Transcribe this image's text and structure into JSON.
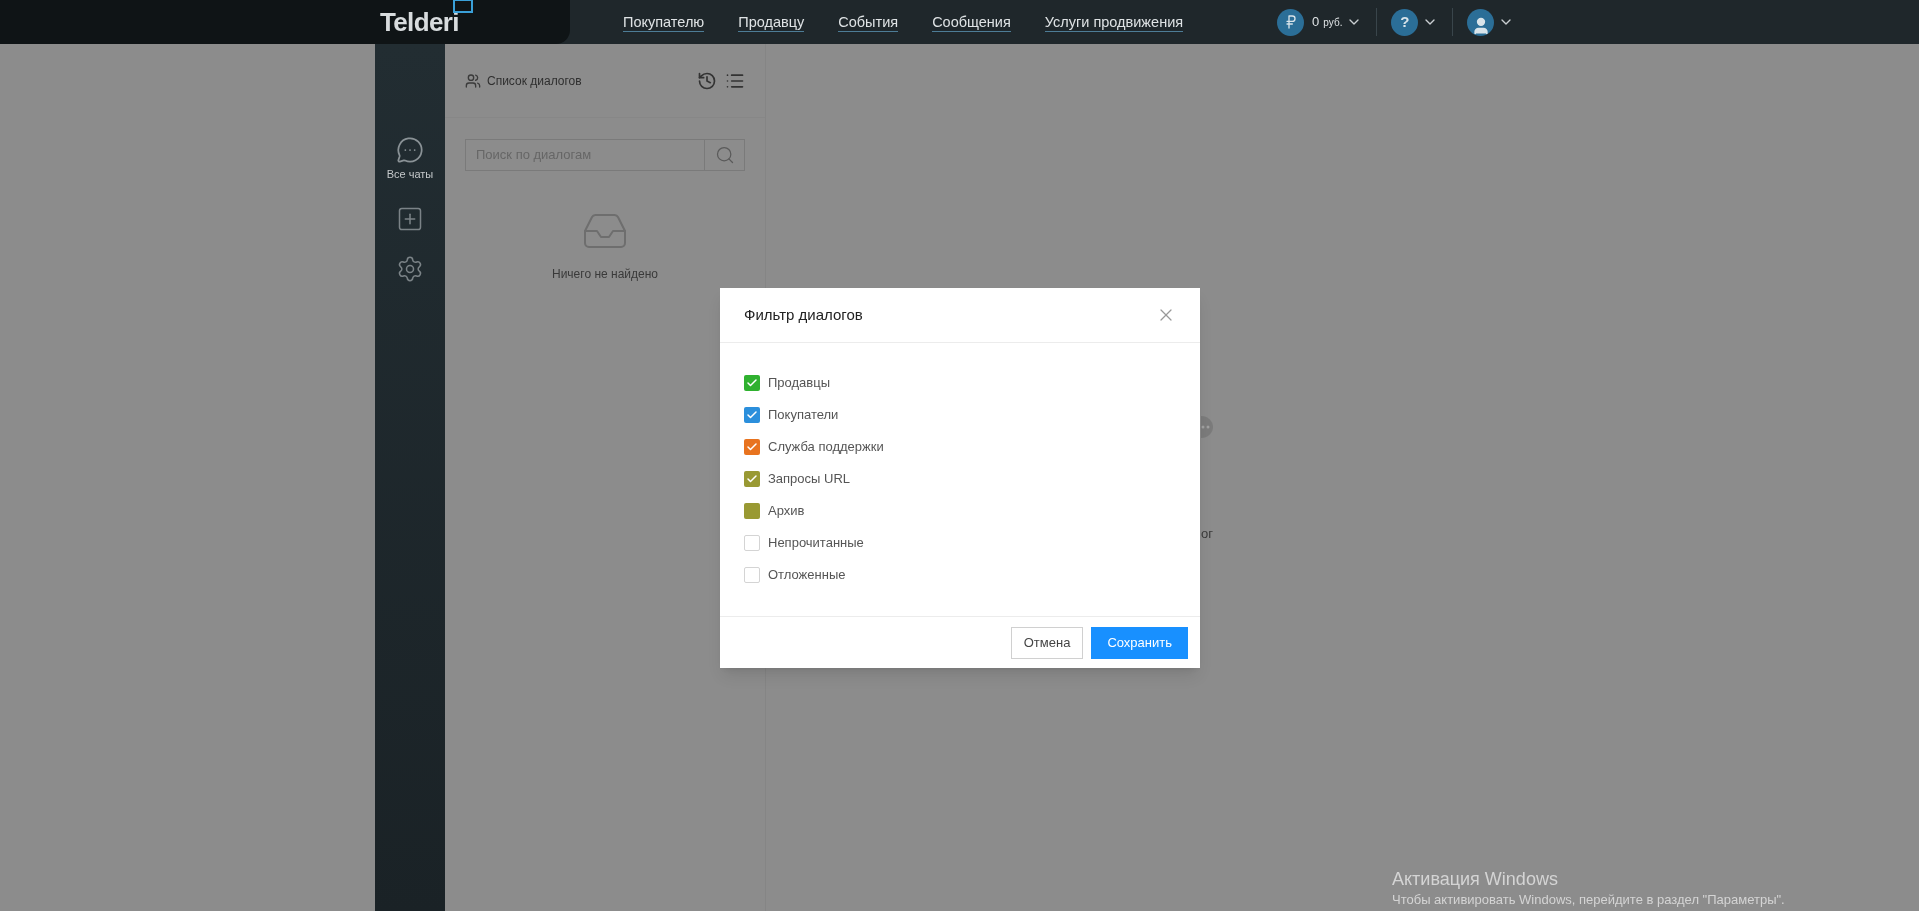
{
  "header": {
    "logo": "Telderi",
    "nav": [
      "Покупателю",
      "Продавцу",
      "События",
      "Сообщения",
      "Услуги продвижения"
    ],
    "balance": {
      "amount": "0",
      "currency": "руб."
    },
    "help": "?"
  },
  "sidebar": {
    "items": [
      {
        "kind": "chats",
        "label": "Все чаты"
      },
      {
        "kind": "add"
      },
      {
        "kind": "settings"
      }
    ]
  },
  "dialog_list": {
    "title": "Список диалогов",
    "search": {
      "placeholder": "Поиск по диалогам"
    },
    "empty": "Ничего не найдено"
  },
  "main": {
    "hint_fragment": "ог"
  },
  "modal": {
    "title": "Фильтр диалогов",
    "options": [
      {
        "label": "Продавцы",
        "checked": true,
        "color": "#2fb12f"
      },
      {
        "label": "Покупатели",
        "checked": true,
        "color": "#2b8fdc"
      },
      {
        "label": "Служба поддержки",
        "checked": true,
        "color": "#e8731f"
      },
      {
        "label": "Запросы URL",
        "checked": true,
        "color": "#999933"
      },
      {
        "label": "Архив",
        "checked": false,
        "color": "#999933"
      },
      {
        "label": "Непрочитанные",
        "checked": false
      },
      {
        "label": "Отложенные",
        "checked": false
      }
    ],
    "buttons": {
      "cancel": "Отмена",
      "save": "Сохранить"
    }
  },
  "os_notice": {
    "title": "Активация Windows",
    "text": "Чтобы активировать Windows, перейдите в раздел \"Параметры\"."
  }
}
